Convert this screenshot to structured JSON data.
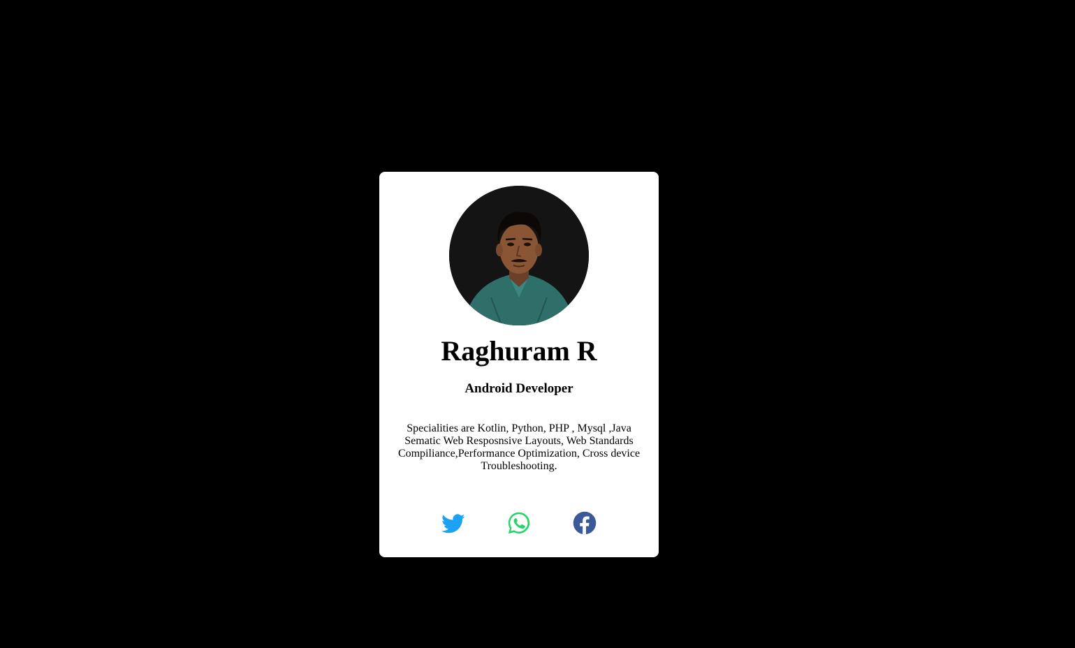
{
  "profile": {
    "name": "Raghuram R",
    "role": "Android Developer",
    "about": "Specialities are Kotlin, Python, PHP , Mysql ,Java Sematic Web Resposnsive Layouts, Web Standards Compiliance,Performance Optimization, Cross device Troubleshooting."
  },
  "socials": [
    {
      "icon": "twitter-icon",
      "color": "#1DA1F2"
    },
    {
      "icon": "whatsapp-icon",
      "color": "#25D366"
    },
    {
      "icon": "facebook-icon",
      "color": "#3B5998"
    }
  ],
  "colors": {
    "background": "#000000",
    "card": "#ffffff"
  }
}
